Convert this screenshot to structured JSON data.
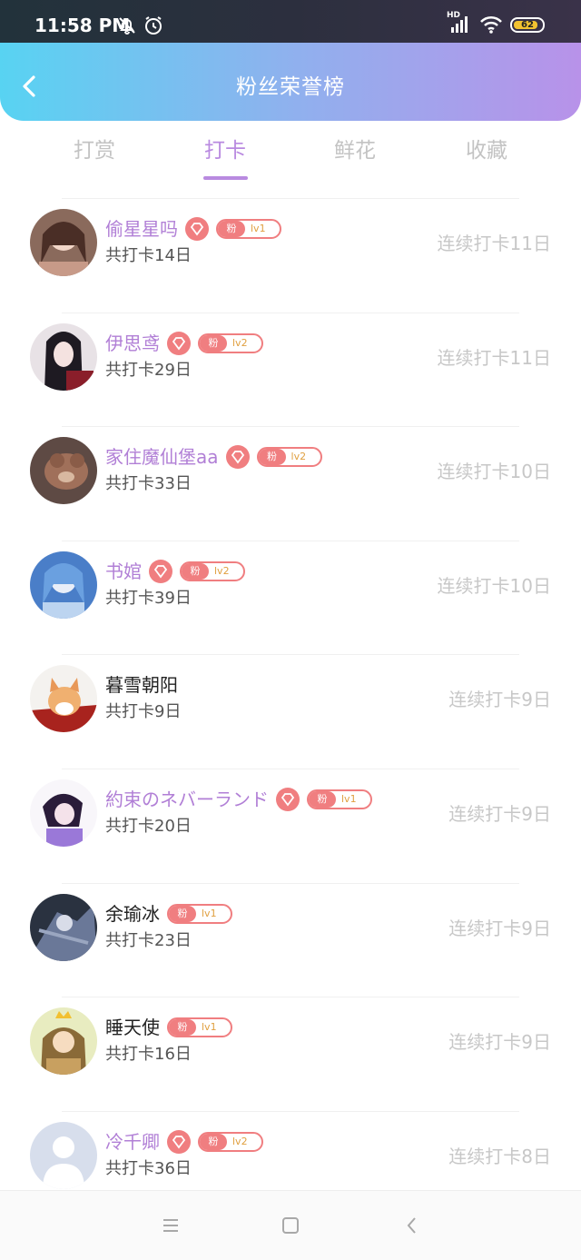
{
  "status_bar": {
    "time": "11:58 PM",
    "icons": [
      "mute-bell-icon",
      "alarm-icon",
      "signal-icon",
      "wifi-icon",
      "battery-icon"
    ],
    "network_label": "HD",
    "battery_level": "62"
  },
  "header": {
    "title": "粉丝荣誉榜",
    "back_icon": "chevron-left-icon"
  },
  "tabs": [
    {
      "label": "打赏",
      "active": false
    },
    {
      "label": "打卡",
      "active": true
    },
    {
      "label": "鲜花",
      "active": false
    },
    {
      "label": "收藏",
      "active": false
    }
  ],
  "fans": [
    {
      "name": "偷星星吗",
      "vip": true,
      "badge_label": "粉",
      "level": "lv1",
      "total": "共打卡14日",
      "streak": "连续打卡11日"
    },
    {
      "name": "伊思鸢",
      "vip": true,
      "badge_label": "粉",
      "level": "lv2",
      "total": "共打卡29日",
      "streak": "连续打卡11日"
    },
    {
      "name": "家住魔仙堡aa",
      "vip": true,
      "badge_label": "粉",
      "level": "lv2",
      "total": "共打卡33日",
      "streak": "连续打卡10日"
    },
    {
      "name": "书婠",
      "vip": true,
      "badge_label": "粉",
      "level": "lv2",
      "total": "共打卡39日",
      "streak": "连续打卡10日"
    },
    {
      "name": "暮雪朝阳",
      "vip": false,
      "badge_label": "",
      "level": "",
      "total": "共打卡9日",
      "streak": "连续打卡9日"
    },
    {
      "name": "約束のネバーランド",
      "vip": true,
      "badge_label": "粉",
      "level": "lv1",
      "total": "共打卡20日",
      "streak": "连续打卡9日"
    },
    {
      "name": "余瑜冰",
      "vip": false,
      "badge_label": "粉",
      "level": "lv1",
      "total": "共打卡23日",
      "streak": "连续打卡9日"
    },
    {
      "name": "睡天使",
      "vip": false,
      "badge_label": "粉",
      "level": "lv1",
      "total": "共打卡16日",
      "streak": "连续打卡9日"
    },
    {
      "name": "冷千卿",
      "vip": true,
      "badge_label": "粉",
      "level": "lv2",
      "total": "共打卡36日",
      "streak": "连续打卡8日"
    }
  ],
  "nav_bar": {
    "icons": [
      "menu-icon",
      "home-square-icon",
      "back-triangle-icon"
    ]
  },
  "colors": {
    "accent": "#b98ae0",
    "vip_name": "#b17fd6",
    "badge": "#f07e80",
    "header_left": "#58d3f2",
    "header_right": "#b892e9"
  }
}
